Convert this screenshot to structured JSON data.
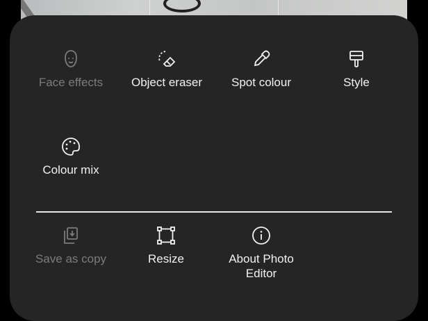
{
  "menu": {
    "row1": [
      {
        "label": "Face effects",
        "icon": "face-icon",
        "enabled": false
      },
      {
        "label": "Object eraser",
        "icon": "eraser-icon",
        "enabled": true
      },
      {
        "label": "Spot colour",
        "icon": "eyedropper-icon",
        "enabled": true
      },
      {
        "label": "Style",
        "icon": "paintbrush-icon",
        "enabled": true
      }
    ],
    "row2": [
      {
        "label": "Colour mix",
        "icon": "palette-icon",
        "enabled": true
      }
    ],
    "row3": [
      {
        "label": "Save as copy",
        "icon": "save-copy-icon",
        "enabled": false
      },
      {
        "label": "Resize",
        "icon": "resize-icon",
        "enabled": true
      },
      {
        "label": "About Photo Editor",
        "icon": "info-icon",
        "enabled": true
      }
    ]
  },
  "colors": {
    "sheet_background": "#252525",
    "text_enabled": "#f2f2f2",
    "text_disabled": "#7c7c7c",
    "divider": "#e6e6e6"
  }
}
